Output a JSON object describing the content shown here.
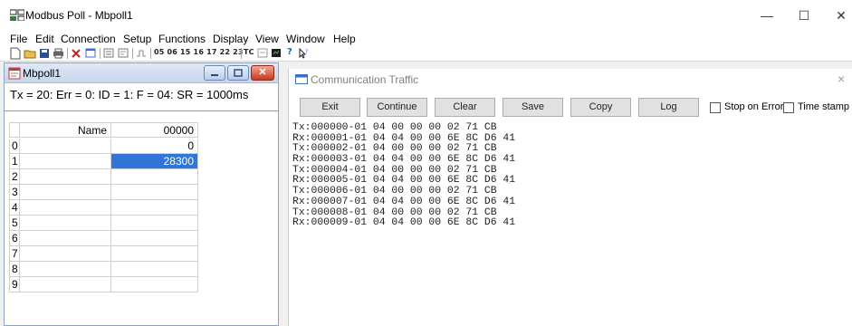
{
  "window": {
    "title": "Modbus Poll - Mbpoll1",
    "minimize": "—",
    "maximize": "☐",
    "close": "✕"
  },
  "menu": {
    "items": [
      "File",
      "Edit",
      "Connection",
      "Setup",
      "Functions",
      "Display",
      "View",
      "Window",
      "Help"
    ]
  },
  "toolbar": {
    "function_codes": "05 06 15 16 17 22 23",
    "tc_label": "TC",
    "help_glyph": "?"
  },
  "child_window": {
    "title": "Mbpoll1",
    "status": "Tx = 20: Err = 0: ID = 1: F = 04: SR = 1000ms",
    "close_glyph": "✕",
    "grid": {
      "headers": {
        "index": "",
        "name": "Name",
        "value": "00000"
      },
      "rows": [
        {
          "index": "0",
          "name": "",
          "value": "0"
        },
        {
          "index": "1",
          "name": "",
          "value": "28300",
          "selected": true
        },
        {
          "index": "2",
          "name": "",
          "value": ""
        },
        {
          "index": "3",
          "name": "",
          "value": ""
        },
        {
          "index": "4",
          "name": "",
          "value": ""
        },
        {
          "index": "5",
          "name": "",
          "value": ""
        },
        {
          "index": "6",
          "name": "",
          "value": ""
        },
        {
          "index": "7",
          "name": "",
          "value": ""
        },
        {
          "index": "8",
          "name": "",
          "value": ""
        },
        {
          "index": "9",
          "name": "",
          "value": ""
        }
      ]
    }
  },
  "traffic": {
    "title": "Communication Traffic",
    "close_glyph": "×",
    "buttons": [
      "Exit",
      "Continue",
      "Clear",
      "Save",
      "Copy",
      "Log"
    ],
    "checkboxes": [
      {
        "label": "Stop on Error",
        "checked": false
      },
      {
        "label": "Time stamp",
        "checked": false
      }
    ],
    "lines": [
      "Tx:000000-01 04 00 00 00 02 71 CB",
      "Rx:000001-01 04 04 00 00 6E 8C D6 41",
      "Tx:000002-01 04 00 00 00 02 71 CB",
      "Rx:000003-01 04 04 00 00 6E 8C D6 41",
      "Tx:000004-01 04 00 00 00 02 71 CB",
      "Rx:000005-01 04 04 00 00 6E 8C D6 41",
      "Tx:000006-01 04 00 00 00 02 71 CB",
      "Rx:000007-01 04 04 00 00 6E 8C D6 41",
      "Tx:000008-01 04 00 00 00 02 71 CB",
      "Rx:000009-01 04 04 00 00 6E 8C D6 41"
    ]
  },
  "colors": {
    "selection": "#3075d8",
    "close_button": "#c8391f"
  }
}
